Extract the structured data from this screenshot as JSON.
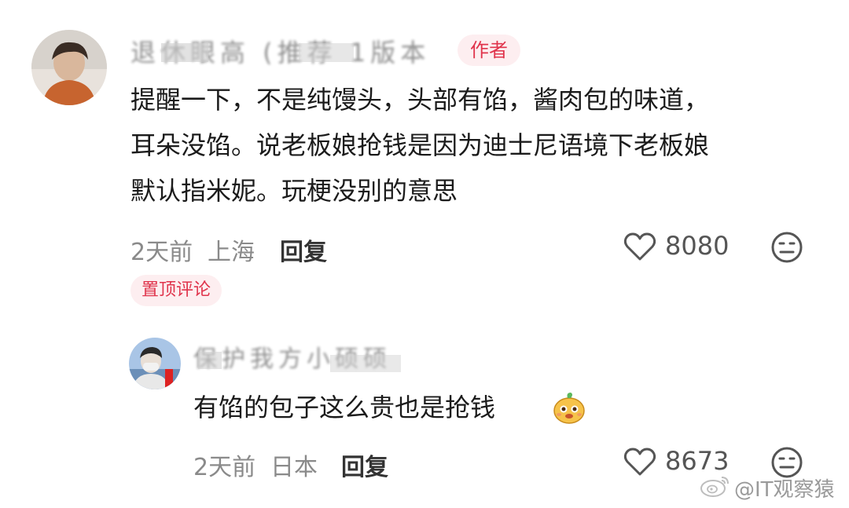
{
  "comment1": {
    "username": "退休眼高 (推荐 1版本",
    "badge": "作者",
    "lines": [
      "提醒一下，不是纯馒头，头部有馅，酱肉包的味道，",
      "耳朵没馅。说老板娘抢钱是因为迪士尼语境下老板娘",
      "默认指米妮。玩梗没别的意思"
    ],
    "time": "2天前",
    "location": "上海",
    "reply_label": "回复",
    "like_count": "8080",
    "pinned_label": "置顶评论"
  },
  "comment2": {
    "username": "保护我方小硕硕",
    "text": "有馅的包子这么贵也是抢钱",
    "emoji": "pudding-face-emoji",
    "time": "2天前",
    "location": "日本",
    "reply_label": "回复",
    "like_count": "8673"
  },
  "watermark": {
    "text": "@IT观察猿",
    "icon": "weibo-logo-icon"
  },
  "colors": {
    "badge_bg": "#fdeef0",
    "badge_text": "#e0344c",
    "meta_text": "#8a8a8a"
  }
}
